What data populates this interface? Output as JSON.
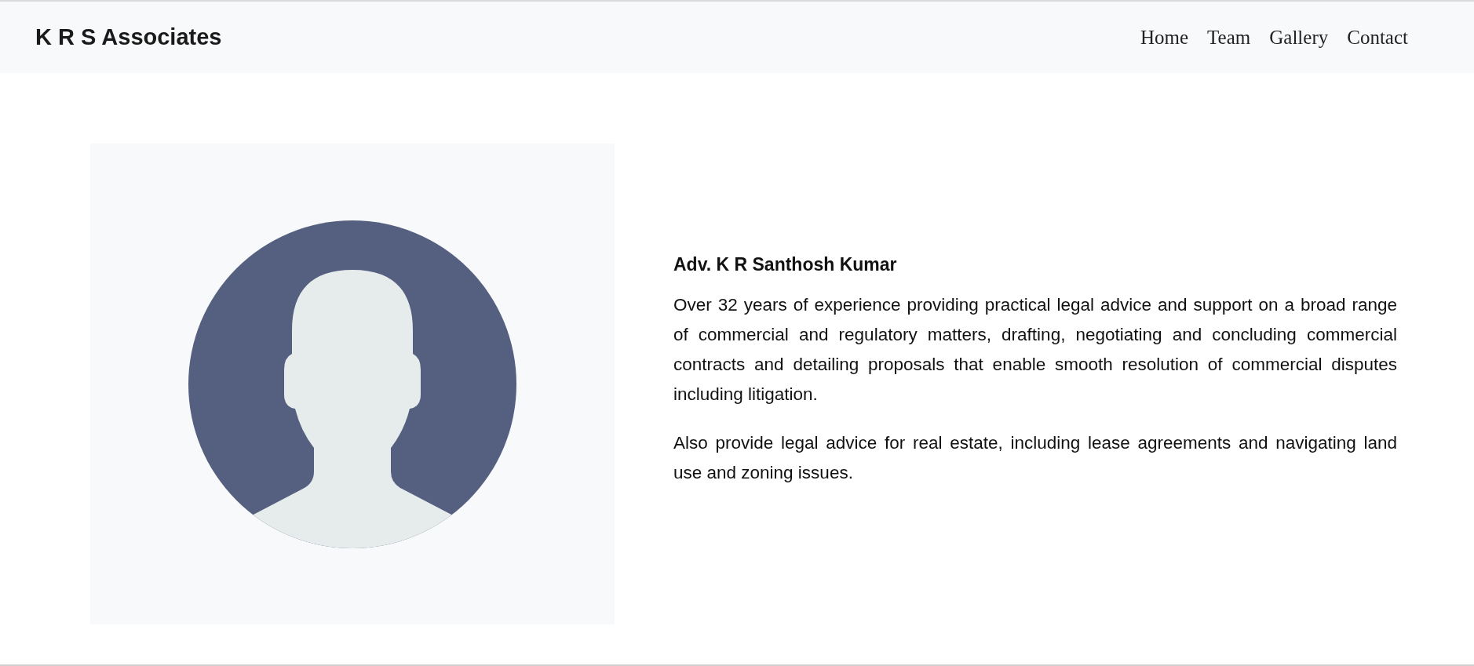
{
  "navbar": {
    "brand": "K R S Associates",
    "links": [
      {
        "label": "Home"
      },
      {
        "label": "Team"
      },
      {
        "label": "Gallery"
      },
      {
        "label": "Contact"
      }
    ]
  },
  "profile": {
    "name": "Adv. K R Santhosh Kumar",
    "paragraphs": [
      "Over 32 years of experience providing practical legal advice and support on a broad range of commercial and regulatory matters, drafting, negotiating and concluding commercial contracts and detailing proposals that enable smooth resolution of commercial disputes including litigation.",
      "Also provide legal advice for real estate, including lease agreements and navigating land use and zoning issues."
    ]
  }
}
